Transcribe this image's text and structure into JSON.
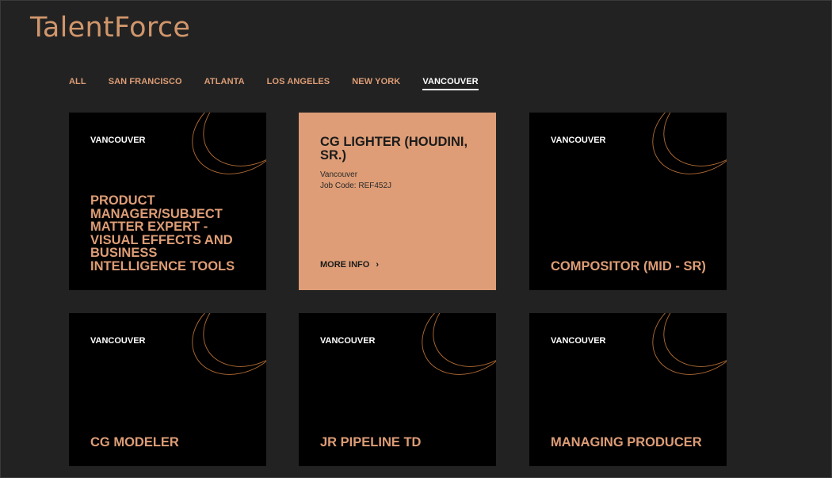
{
  "brand": {
    "name": "TalentForce",
    "accent_color": "#de9d76",
    "background_color": "#222222"
  },
  "filters": [
    {
      "label": "ALL",
      "active": false
    },
    {
      "label": "SAN FRANCISCO",
      "active": false
    },
    {
      "label": "ATLANTA",
      "active": false
    },
    {
      "label": "LOS ANGELES",
      "active": false
    },
    {
      "label": "NEW YORK",
      "active": false
    },
    {
      "label": "VANCOUVER",
      "active": true
    }
  ],
  "jobs": [
    {
      "location": "VANCOUVER",
      "title": "PRODUCT MANAGER/SUBJECT MATTER EXPERT - VISUAL EFFECTS AND BUSINESS INTELLIGENCE TOOLS"
    },
    {
      "location": "",
      "title": "CG LIGHTER (HOUDINI, SR.)",
      "city": "Vancouver",
      "job_code": "Job Code: REF452J",
      "more_info": "MORE INFO",
      "more_icon": "chevron-right-icon",
      "highlighted": true
    },
    {
      "location": "VANCOUVER",
      "title": "COMPOSITOR (MID - SR)"
    },
    {
      "location": "VANCOUVER",
      "title": "CG MODELER"
    },
    {
      "location": "VANCOUVER",
      "title": "JR PIPELINE TD"
    },
    {
      "location": "VANCOUVER",
      "title": "MANAGING PRODUCER"
    }
  ]
}
